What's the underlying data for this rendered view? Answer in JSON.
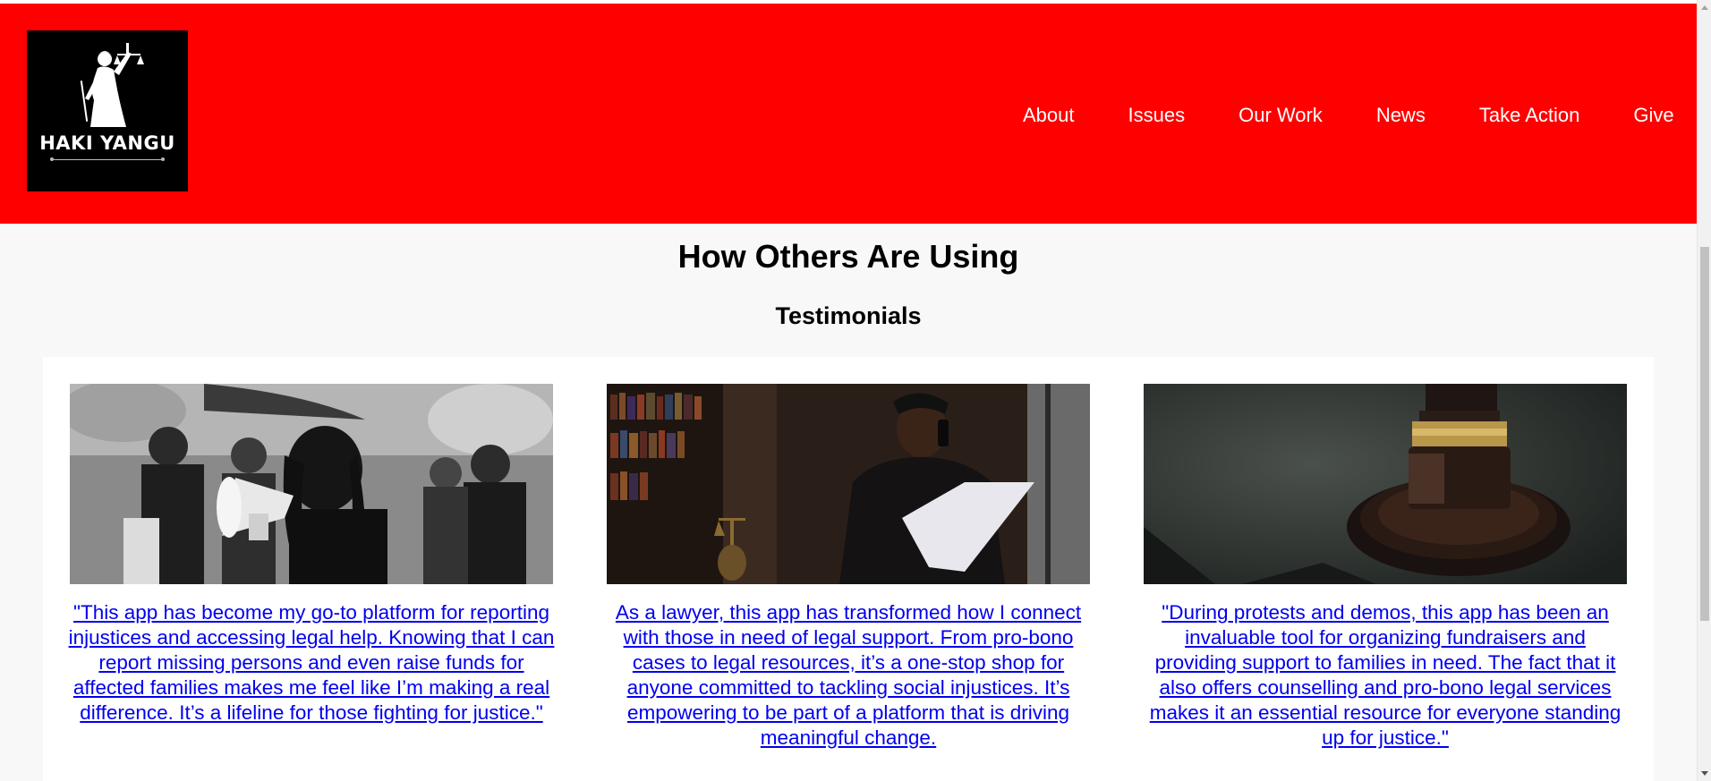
{
  "header": {
    "background": "#ff0000",
    "logo_text": "HAKI YANGU",
    "logo_icon": "lady-justice-icon",
    "nav": [
      "About",
      "Issues",
      "Our Work",
      "News",
      "Take Action",
      "Give"
    ]
  },
  "main": {
    "title": "How Others Are Using",
    "subtitle": "Testimonials",
    "link_color": "#0000ee",
    "cards": [
      {
        "image": "protest-megaphone-photo",
        "quote": "\"This app has become my go-to platform for reporting injustices and accessing legal help. Knowing that I can report missing persons and even raise funds for affected families makes me feel like I’m making a real difference. It’s a lifeline for those fighting for justice.\""
      },
      {
        "image": "lawyer-reading-document-photo",
        "quote": "As a lawyer, this app has transformed how I connect with those in need of legal support. From pro-bono cases to legal resources, it’s a one-stop shop for anyone committed to tackling social injustices. It’s empowering to be part of a platform that is driving meaningful change."
      },
      {
        "image": "gavel-photo",
        "quote": "\"During protests and demos, this app has been an invaluable tool for organizing fundraisers and providing support to families in need. The fact that it also offers counselling and pro-bono legal services makes it an essential resource for everyone standing up for justice.\""
      }
    ]
  }
}
